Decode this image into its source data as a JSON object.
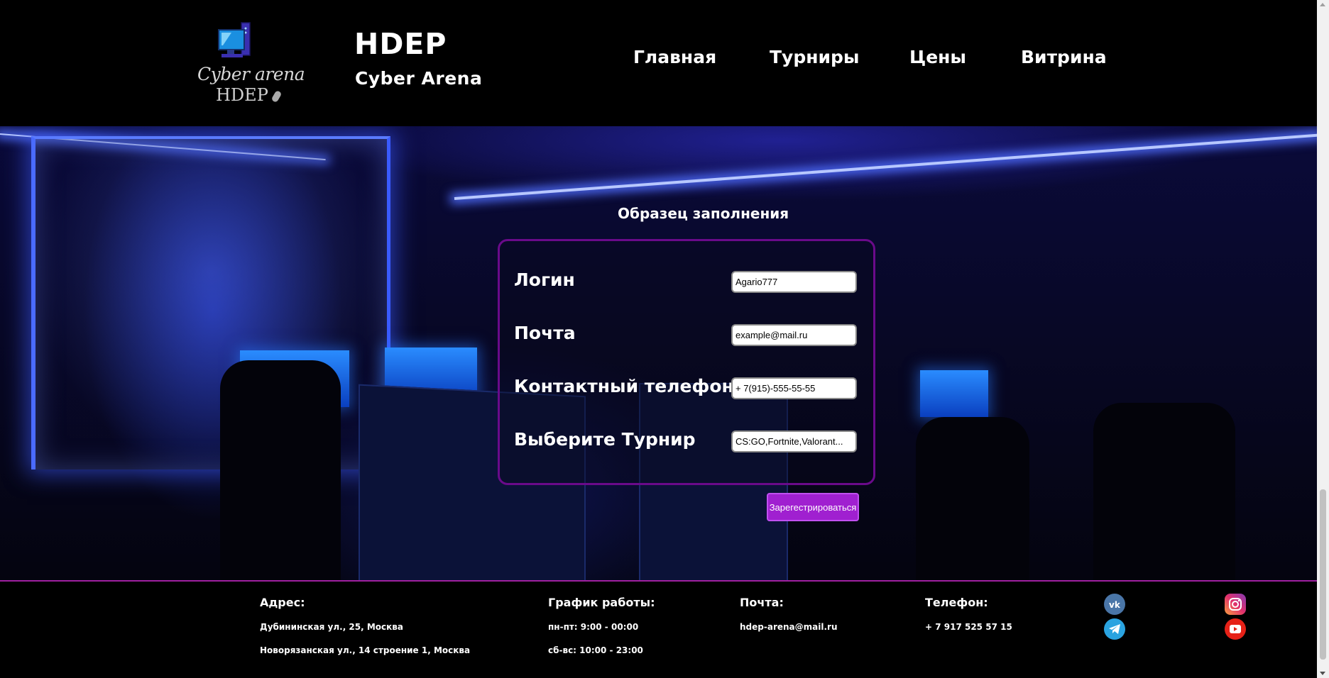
{
  "header": {
    "logo": {
      "line1": "Cyber arena",
      "line2": "HDEP"
    },
    "brand_title": "HDEP",
    "brand_subtitle": "Cyber Arena",
    "nav": [
      "Главная",
      "Турниры",
      "Цены",
      "Витрина"
    ]
  },
  "form": {
    "title": "Образец заполнения",
    "fields": [
      {
        "label": "Логин",
        "value": "Agario777"
      },
      {
        "label": "Почта",
        "value": "example@mail.ru"
      },
      {
        "label": "Контактный телефон",
        "value": "+ 7(915)-555-55-55"
      },
      {
        "label": "Выберите Турнир",
        "value": "CS:GO,Fortnite,Valorant..."
      }
    ],
    "submit_label": "Зарегестрироваться"
  },
  "footer": {
    "address": {
      "heading": "Адрес:",
      "lines": [
        "Дубининская ул., 25, Москва",
        "Новорязанская ул., 14 строение 1, Москва"
      ]
    },
    "schedule": {
      "heading": "График работы:",
      "lines": [
        "пн-пт: 9:00 - 00:00",
        "сб-вс: 10:00 - 23:00"
      ]
    },
    "mail": {
      "heading": "Почта:",
      "value": "hdep-arena@mail.ru"
    },
    "phone": {
      "heading": "Телефон:",
      "value": "+ 7 917 525 57 15"
    },
    "socials": [
      "vk-icon",
      "instagram-icon",
      "telegram-icon",
      "youtube-icon"
    ]
  },
  "colors": {
    "accent_purple": "#a020d0",
    "form_border": "#6a0a8a",
    "footer_border": "#a020a0",
    "vk_blue": "#4a76a8",
    "telegram_blue": "#2aa3e0",
    "youtube_red": "#e62117"
  }
}
